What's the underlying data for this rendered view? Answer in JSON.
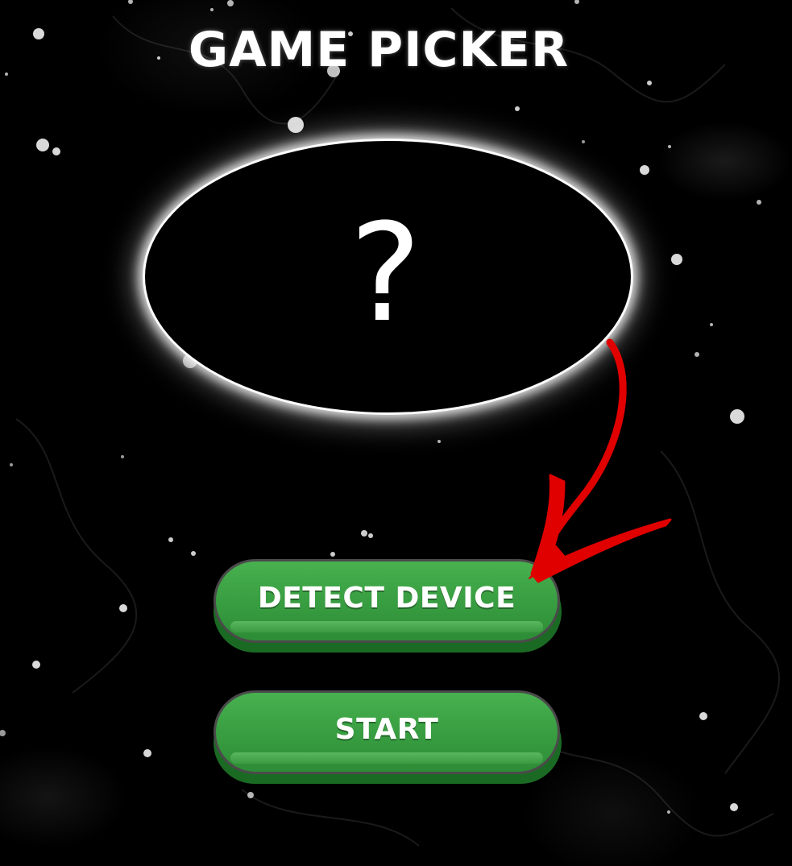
{
  "title": "GAME PICKER",
  "picker": {
    "placeholder_symbol": "?"
  },
  "buttons": {
    "detect_label": "DETECT DEVICE",
    "start_label": "START"
  },
  "colors": {
    "background": "#000000",
    "button_green": "#3aa043",
    "button_green_dark": "#1b6a24",
    "arrow_red": "#e00000",
    "glow": "#ffffff"
  }
}
